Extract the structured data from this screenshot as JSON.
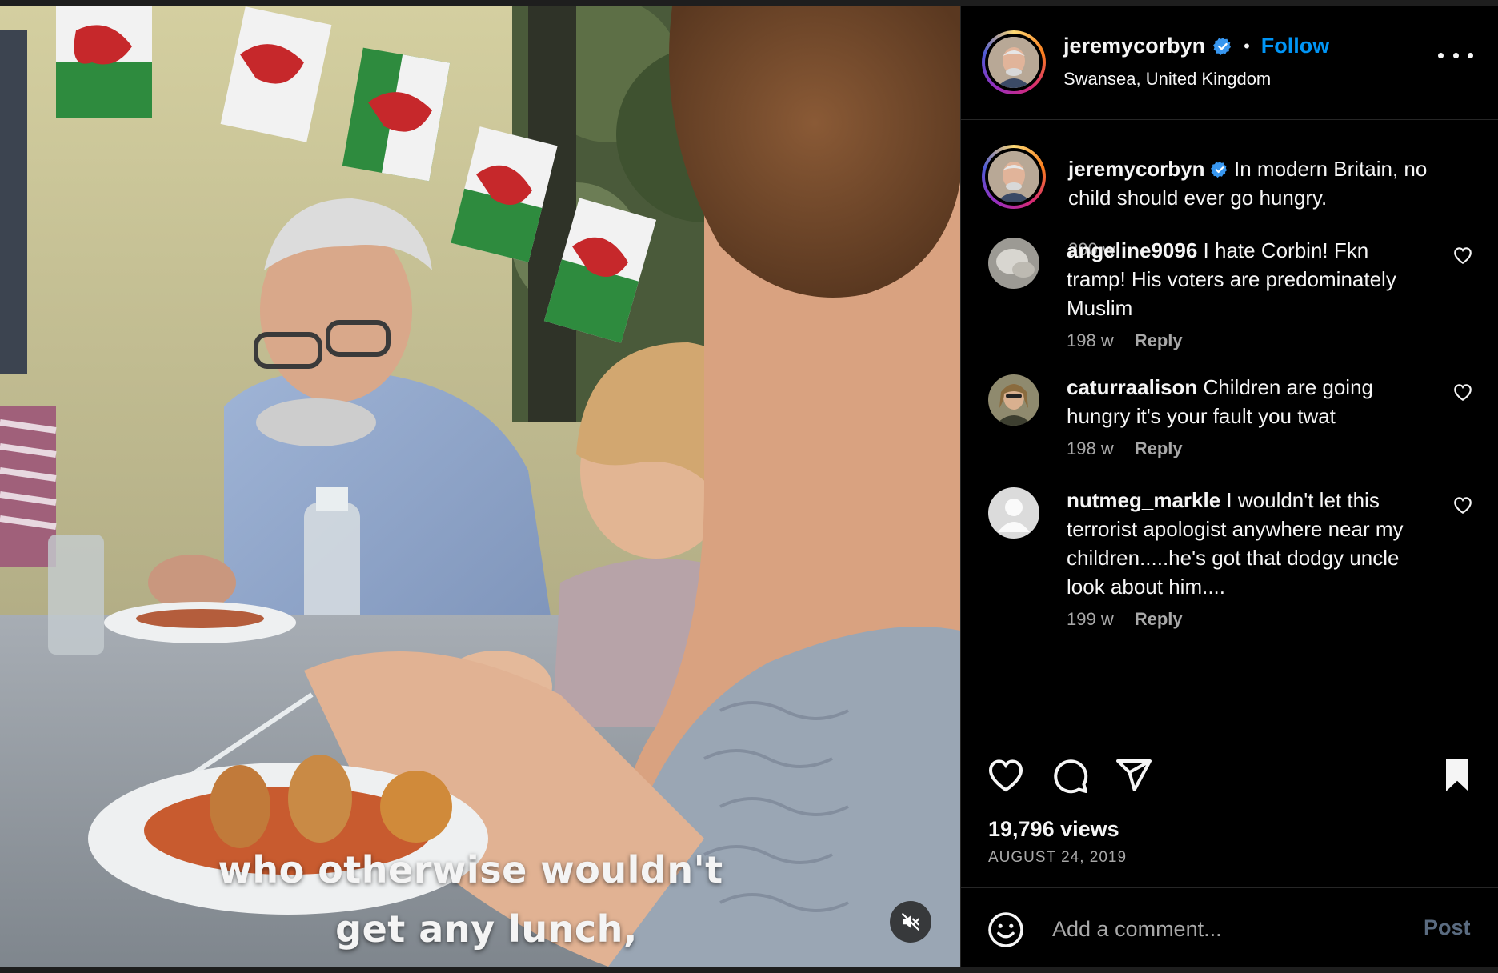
{
  "post": {
    "username": "jeremycorbyn",
    "follow_label": "Follow",
    "separator": "•",
    "location": "Swansea, United Kingdom",
    "caption_text": "In modern Britain, no child should ever go hungry.",
    "caption_time": "200 w"
  },
  "video": {
    "subtitle_line1": "who otherwise wouldn't",
    "subtitle_line2": "get any lunch,",
    "muted": true
  },
  "comments": [
    {
      "username": "angeline9096",
      "text": "I hate Corbin! Fkn tramp! His voters are predominately Muslim",
      "time": "198 w",
      "reply_label": "Reply"
    },
    {
      "username": "caturraalison",
      "text": "Children are going hungry it's your fault you twat",
      "time": "198 w",
      "reply_label": "Reply"
    },
    {
      "username": "nutmeg_markle",
      "text": "I wouldn't let this terrorist apologist anywhere near my children.....he's got that dodgy uncle look about him....",
      "time": "199 w",
      "reply_label": "Reply"
    }
  ],
  "stats": {
    "views": "19,796 views",
    "date": "AUGUST 24, 2019"
  },
  "composer": {
    "placeholder": "Add a comment...",
    "post_label": "Post"
  },
  "icons": {
    "verified": "verified-badge-icon",
    "like": "heart-icon",
    "comment": "comment-bubble-icon",
    "share": "paper-plane-icon",
    "save": "bookmark-icon",
    "emoji": "smiley-icon",
    "mute": "speaker-muted-icon",
    "more": "ellipsis-icon"
  },
  "colors": {
    "link_blue": "#0095f6",
    "verified_blue": "#3897f0",
    "muted_text": "#a8a8a8",
    "post_disabled": "#5a6b80"
  }
}
